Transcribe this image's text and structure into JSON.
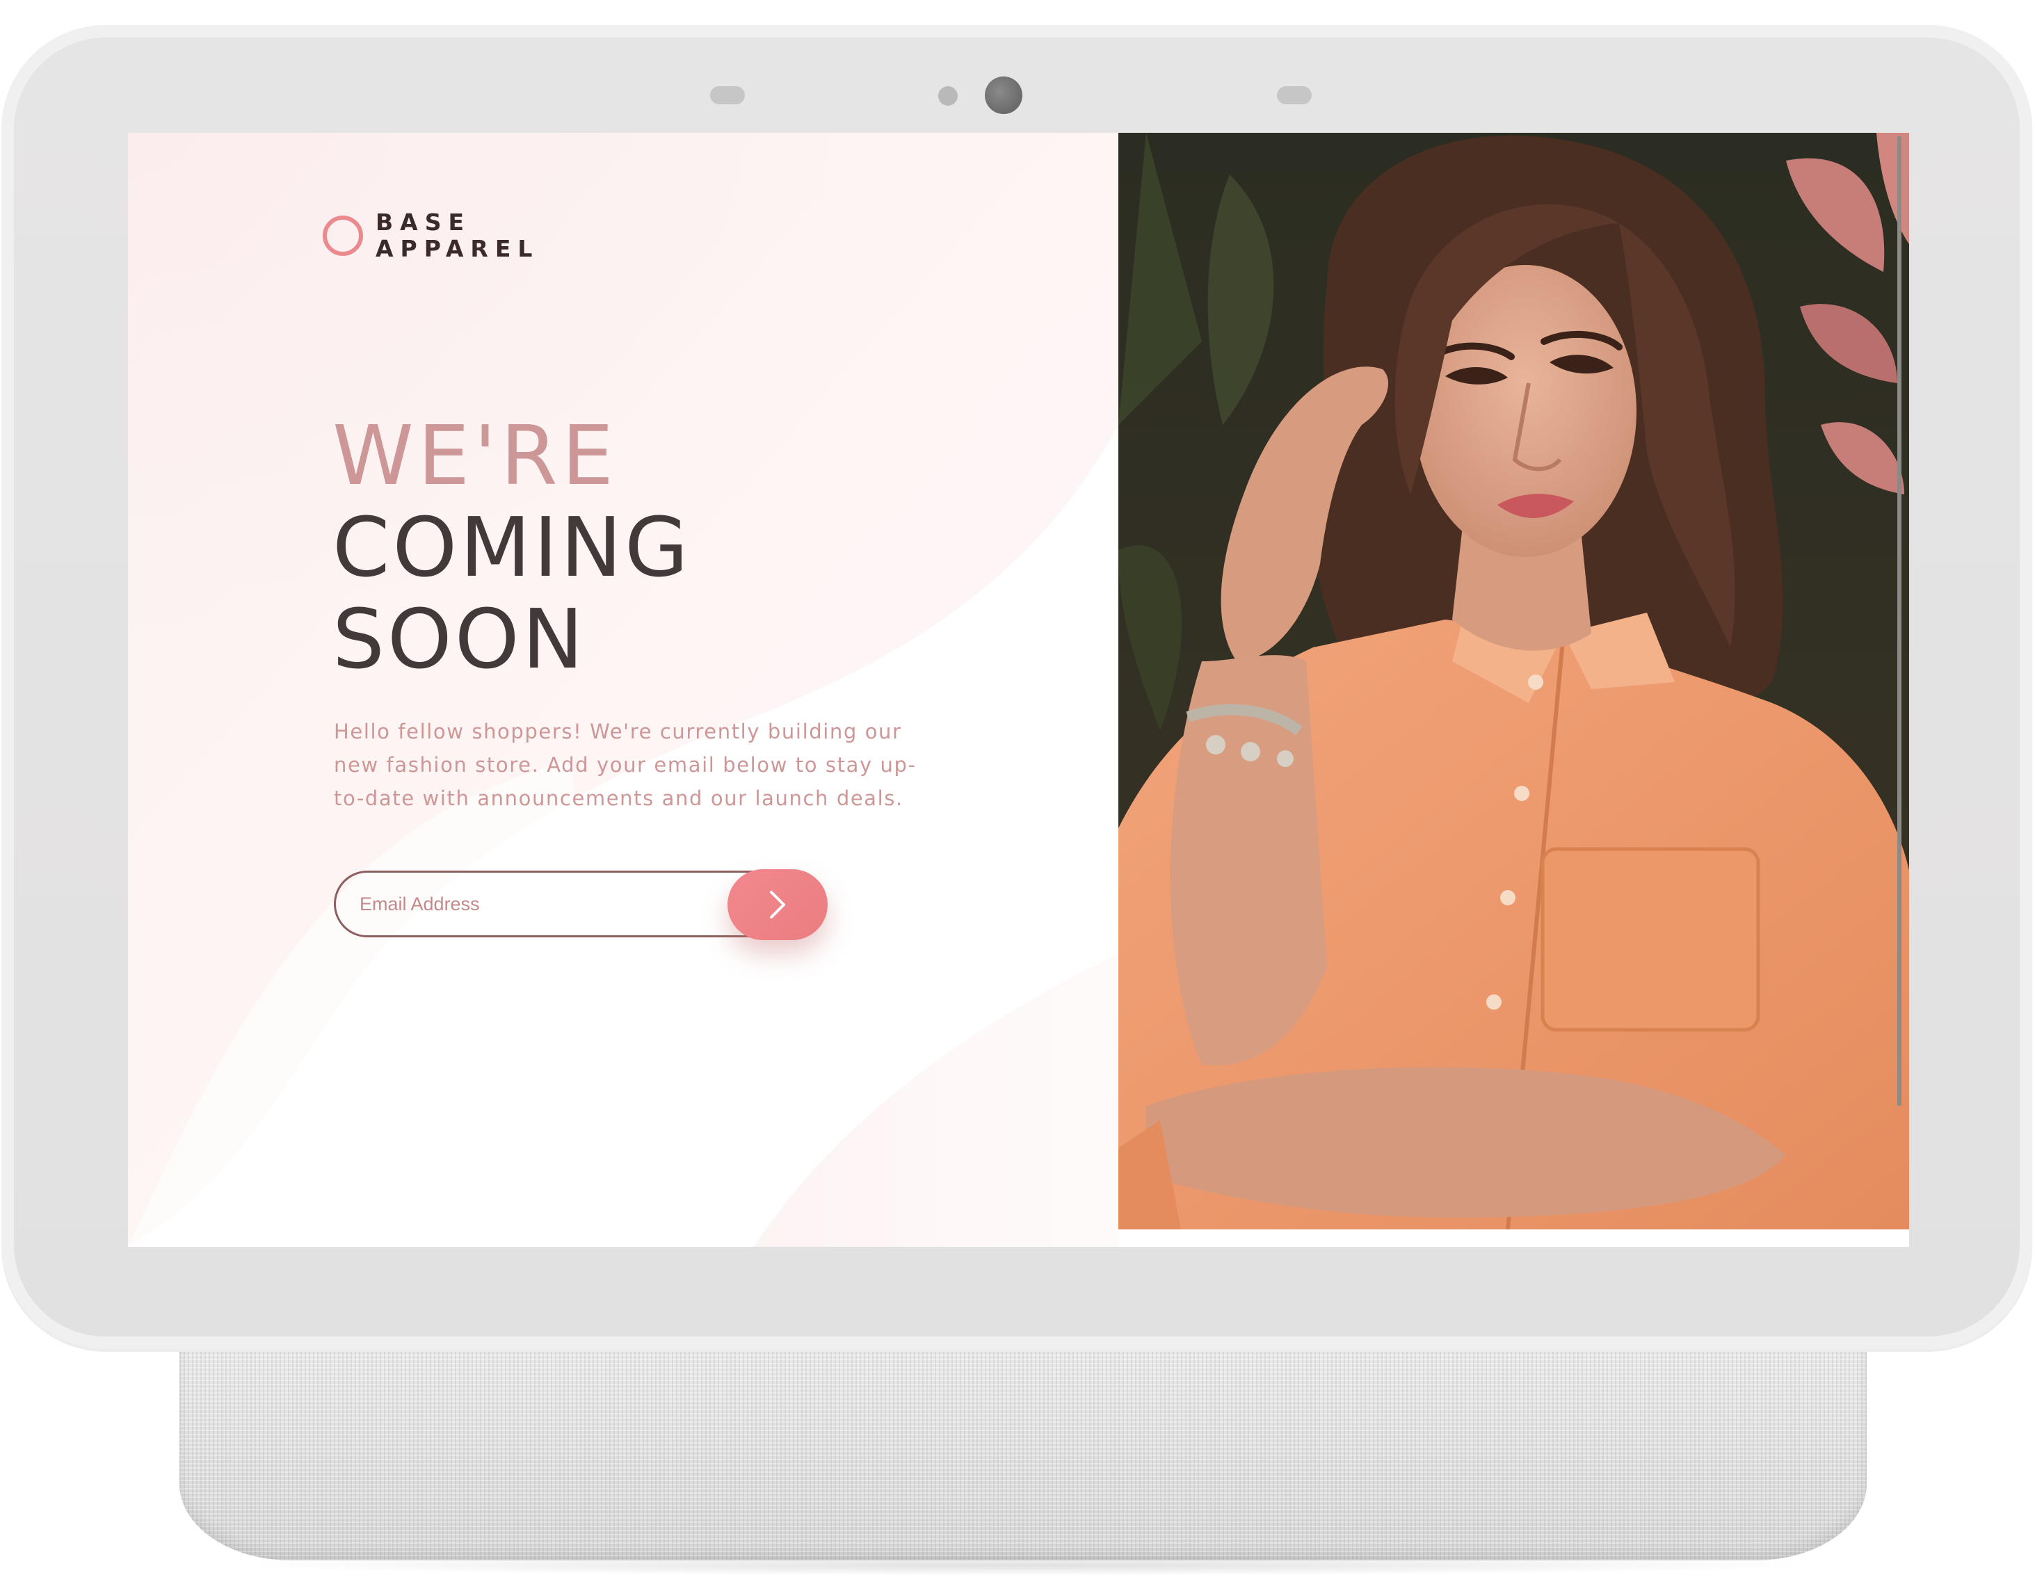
{
  "brand": {
    "line1": "BASE",
    "line2": "APPAREL",
    "ring_color": "#ea8a8e"
  },
  "headline": {
    "light": "WE'RE",
    "dark1": "COMING",
    "dark2": "SOON"
  },
  "intro": "Hello fellow shoppers! We're currently building our new fashion store. Add your email below to stay up-to-date with announcements and our launch deals.",
  "form": {
    "email_placeholder": "Email Address",
    "submit_icon": "chevron-right-icon"
  },
  "hero": {
    "image_desc": "hero-photo"
  },
  "colors": {
    "accent": "#ea8a8e",
    "accent_text": "#ce9797",
    "heading_dark": "#423a3a",
    "bezel": "#e4e3e3"
  }
}
